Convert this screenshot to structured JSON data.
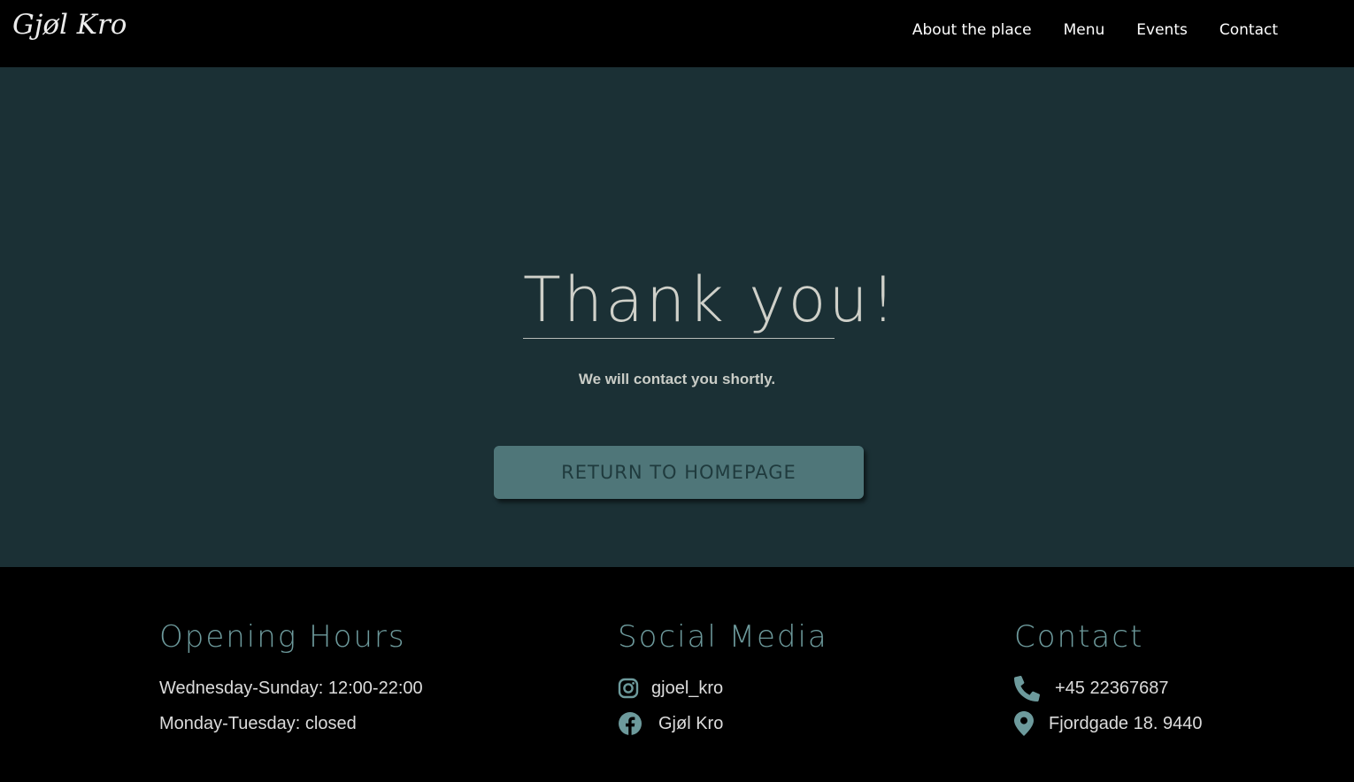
{
  "nav": {
    "logo": "Gjøl Kro",
    "links": [
      "About the place",
      "Menu",
      "Events",
      "Contact"
    ]
  },
  "hero": {
    "title": "Thank you!",
    "subtitle": "We will contact you shortly.",
    "button_label": "RETURN TO HOMEPAGE"
  },
  "footer": {
    "hours": {
      "title": "Opening Hours",
      "lines": [
        "Wednesday-Sunday: 12:00-22:00",
        "Monday-Tuesday: closed"
      ]
    },
    "social": {
      "title": "Social Media",
      "instagram": "gjoel_kro",
      "facebook": "Gjøl Kro"
    },
    "contact": {
      "title": "Contact",
      "phone": "+45 22367687",
      "address": "Fjordgade 18. 9440"
    }
  },
  "icons": {
    "instagram": "instagram-icon",
    "facebook": "facebook-icon",
    "phone": "phone-icon",
    "location": "location-pin-icon"
  },
  "colors": {
    "hero_bg": "#1b3035",
    "accent": "#6d9a9c",
    "button_bg": "#4f7679"
  }
}
